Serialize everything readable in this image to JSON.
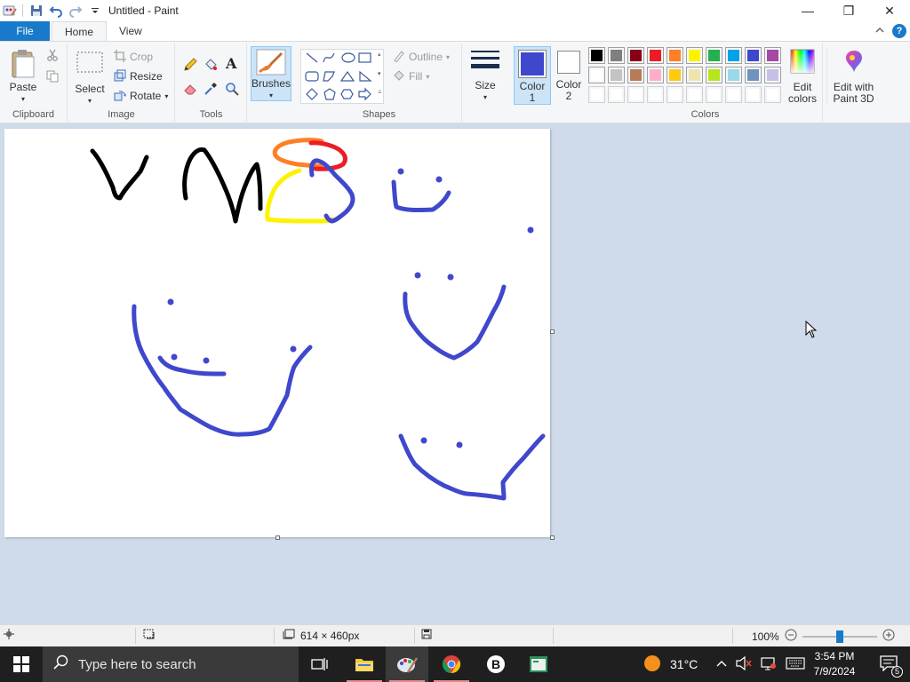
{
  "window": {
    "title": "Untitled - Paint",
    "minimize_glyph": "—",
    "maximize_glyph": "❐",
    "close_glyph": "✕"
  },
  "tabs": {
    "file": "File",
    "home": "Home",
    "view": "View"
  },
  "ribbon": {
    "clipboard": {
      "label": "Clipboard",
      "paste": "Paste"
    },
    "image": {
      "label": "Image",
      "select": "Select",
      "crop": "Crop",
      "resize": "Resize",
      "rotate": "Rotate"
    },
    "tools": {
      "label": "Tools"
    },
    "brushes": {
      "label": "Brushes"
    },
    "shapes": {
      "label": "Shapes",
      "outline": "Outline",
      "fill": "Fill"
    },
    "size": {
      "label": "Size"
    },
    "color1": {
      "label_line1": "Color",
      "label_line2": "1",
      "value": "#3f48cc"
    },
    "color2": {
      "label_line1": "Color",
      "label_line2": "2",
      "value": "#ffffff"
    },
    "colors": {
      "label": "Colors",
      "row1": [
        "#000000",
        "#7f7f7f",
        "#880015",
        "#ed1c24",
        "#ff7f27",
        "#fff200",
        "#22b14c",
        "#00a2e8",
        "#3f48cc",
        "#a349a4"
      ],
      "row2": [
        "#ffffff",
        "#c3c3c3",
        "#b97a57",
        "#ffaec9",
        "#ffc90e",
        "#efe4b0",
        "#b5e61d",
        "#99d9ea",
        "#7092be",
        "#c8bfe7"
      ],
      "row3": [
        "#ffffff",
        "#ffffff",
        "#ffffff",
        "#ffffff",
        "#ffffff",
        "#ffffff",
        "#ffffff",
        "#ffffff",
        "#ffffff",
        "#ffffff"
      ]
    },
    "edit_colors": {
      "line1": "Edit",
      "line2": "colors"
    },
    "paint3d": {
      "line1": "Edit with",
      "line2": "Paint 3D"
    }
  },
  "status": {
    "dimensions": "614 × 460px",
    "zoom": "100%",
    "zoom_level_percent": 100
  },
  "taskbar": {
    "search_placeholder": "Type here to search",
    "weather": "31°C",
    "time": "3:54 PM",
    "date": "7/9/2024",
    "notifications": "5"
  }
}
